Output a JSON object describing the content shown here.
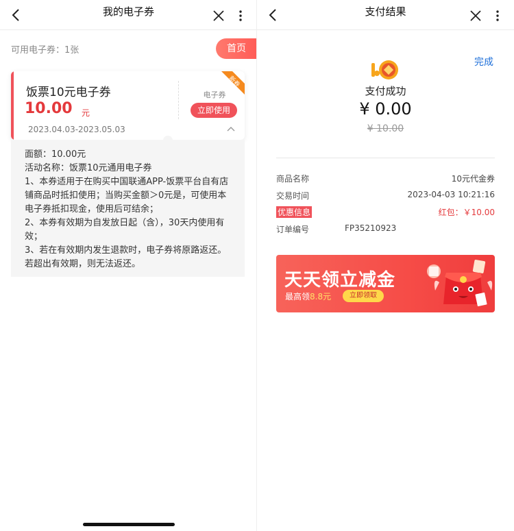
{
  "left": {
    "nav": {
      "title": "我的电子券",
      "back_icon": "back-chevron-icon",
      "close_icon": "close-icon",
      "more_icon": "more-vertical-icon"
    },
    "available_label": "可用电子券：1张",
    "home_button": "首页",
    "coupon": {
      "name": "饭票10元电子券",
      "amount": "10.00",
      "unit": "元",
      "dates": "2023.04.03-2023.05.03",
      "type": "电子券",
      "use_button": "立即使用",
      "new_badge": "新券",
      "expand_icon": "chevron-up-icon"
    },
    "details": {
      "face_value": "面额：10.00元",
      "activity": "活动名称：饭票10元通用电子券",
      "rules": [
        "1、本券适用于在购买中国联通APP-饭票平台自有店铺商品时抵扣使用；当购买金额＞0元是，可使用本电子券抵扣现金，使用后可结余；",
        "2、本券有效期为自发放日起（含），30天内使用有效；",
        "3、若在有效期内发生退款时，电子券将原路返还。若超出有效期，则无法返还。"
      ]
    }
  },
  "right": {
    "nav": {
      "title": "支付结果",
      "back_icon": "back-chevron-icon",
      "close_icon": "close-icon",
      "more_icon": "more-vertical-icon"
    },
    "done": "完成",
    "success_text": "支付成功",
    "paid_amount": "¥ 0.00",
    "original_amount": "¥ 10.00",
    "rows": [
      {
        "label": "商品名称",
        "value": "10元代金券"
      },
      {
        "label": "交易时间",
        "value": "2023-04-03 10:21:16"
      },
      {
        "label": "优惠信息",
        "value": "红包：￥10.00"
      },
      {
        "label": "订单编号",
        "value": "FP35210923"
      }
    ],
    "banner": {
      "title": "天天领立减金",
      "sub_prefix": "最高领",
      "sub_amount": "8.8元",
      "button": "立即领取"
    }
  },
  "colors": {
    "accent_red": "#f0525a",
    "link_blue": "#1e6fd9",
    "banner_red": "#f64c47",
    "banner_yellow": "#ffd84a"
  }
}
